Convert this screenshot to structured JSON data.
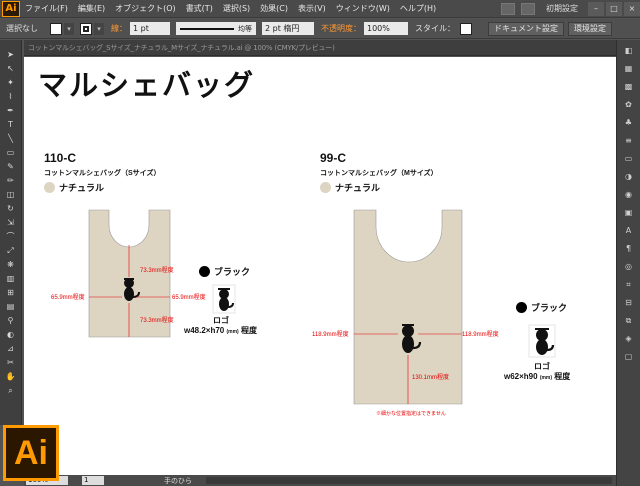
{
  "menubar": {
    "logo": "Ai",
    "items": [
      "ファイル(F)",
      "編集(E)",
      "オブジェクト(O)",
      "書式(T)",
      "選択(S)",
      "効果(C)",
      "表示(V)",
      "ウィンドウ(W)",
      "ヘルプ(H)"
    ],
    "workspace": "初期設定",
    "window_buttons": [
      "–",
      "□",
      "×"
    ]
  },
  "controlbar": {
    "selection": "選択なし",
    "stroke_label": "線：",
    "stroke_weight": "1 pt",
    "profile_label": "均等",
    "brush": "2 pt 楕円",
    "opacity_label": "不透明度：",
    "opacity_value": "100%",
    "style_label": "スタイル：",
    "doc_setup": "ドキュメント設定",
    "prefs": "環境設定"
  },
  "document_tab": {
    "title": "コットンマルシェバッグ_Sサイズ_ナチュラル_Mサイズ_ナチュラル.ai @ 100% (CMYK/プレビュー)"
  },
  "artboard": {
    "title": "マルシェバッグ",
    "products": [
      {
        "code": "110-C",
        "name": "コットンマルシェバッグ（Sサイズ）",
        "bag_color": "ナチュラル",
        "dims": {
          "top": "73.3mm程度",
          "bottom": "73.3mm程度",
          "left": "65.9mm程度",
          "right": "65.9mm程度"
        },
        "print_color": "ブラック",
        "logo_label": "ロゴ",
        "logo_size": "w48.2×h70",
        "logo_unit": "(mm)",
        "logo_suffix": "程度"
      },
      {
        "code": "99-C",
        "name": "コットンマルシェバッグ（Mサイズ）",
        "bag_color": "ナチュラル",
        "dims": {
          "left": "118.9mm程度",
          "right": "118.9mm程度",
          "bottom": "130.1mm程度"
        },
        "print_color": "ブラック",
        "logo_label": "ロゴ",
        "logo_size": "w62×h90",
        "logo_unit": "(mm)",
        "logo_suffix": "程度",
        "note": "※細かな位置指定はできません"
      }
    ]
  },
  "statusbar": {
    "zoom": "100%",
    "page": "1",
    "tool": "手のひら"
  },
  "colors": {
    "natural": "#ddd4c2",
    "dimension_red": "#e60000",
    "ai_orange": "#ff9a00"
  },
  "icons": [
    "selection-tool-icon",
    "direct-selection-icon",
    "magic-wand-icon",
    "lasso-icon",
    "pen-icon",
    "type-icon",
    "line-icon",
    "rectangle-icon",
    "paintbrush-icon",
    "pencil-icon",
    "eraser-icon",
    "rotate-icon",
    "scale-icon",
    "warp-icon",
    "free-transform-icon",
    "symbol-sprayer-icon",
    "graph-icon",
    "mesh-icon",
    "gradient-icon",
    "eyedropper-icon",
    "blend-icon",
    "slice-icon",
    "scissors-icon",
    "hand-icon",
    "zoom-icon"
  ]
}
